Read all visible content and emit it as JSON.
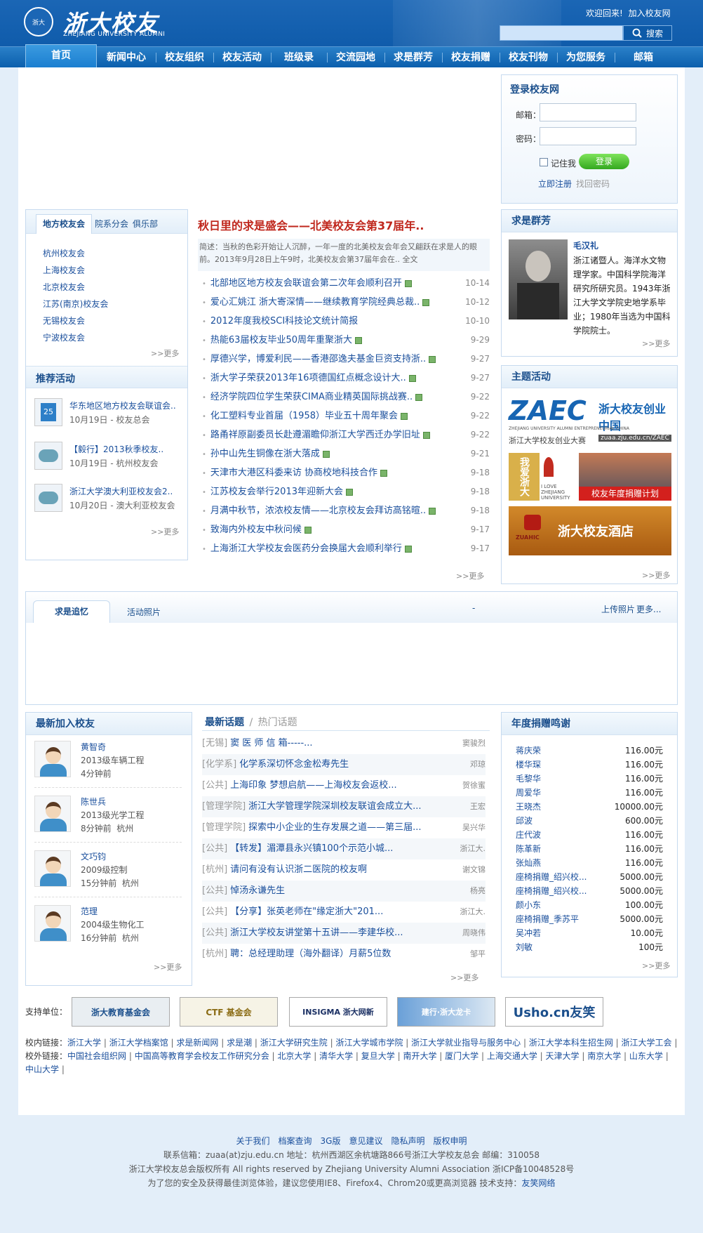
{
  "header": {
    "logo_seal": "浙大",
    "logo_text": "浙大校友",
    "logo_sub": "ZHEJIANG UNIVERSITY ALUMNI",
    "welcome": "欢迎回来!",
    "join": "加入校友网",
    "search_placeholder": "",
    "search_label": "搜索"
  },
  "nav": [
    "首页",
    "新闻中心",
    "校友组织",
    "校友活动",
    "班级录",
    "交流园地",
    "求是群芳",
    "校友捐赠",
    "校友刊物",
    "为您服务",
    "邮箱"
  ],
  "login": {
    "title": "登录校友网",
    "email_label": "邮箱：",
    "password_label": "密码：",
    "remember": "记住我",
    "submit": "登录",
    "register": "立即注册",
    "forgot": "找回密码"
  },
  "local": {
    "tabs": [
      "地方校友会",
      "院系分会",
      "俱乐部"
    ],
    "items": [
      "杭州校友会",
      "上海校友会",
      "北京校友会",
      "江苏(南京)校友会",
      "无锡校友会",
      "宁波校友会"
    ],
    "more": ">>更多"
  },
  "recommend": {
    "title": "推荐活动",
    "items": [
      {
        "title": "华东地区地方校友会联谊会..",
        "meta": "10月19日 - 校友总会",
        "badge": "25"
      },
      {
        "title": "【毅行】2013秋季校友..",
        "meta": "10月19日 - 杭州校友会",
        "badge": ""
      },
      {
        "title": "浙江大学澳大利亚校友会2..",
        "meta": "10月20日 - 澳大利亚校友会",
        "badge": ""
      }
    ],
    "more": ">>更多"
  },
  "headline": {
    "title": "秋日里的求是盛会——北美校友会第37届年..",
    "summary": "简述：当秋的色彩开始让人沉醉，一年一度的北美校友会年会又翩跃在求是人的眼前。2013年9月28日上午9时，北美校友会第37届年会在..  全文"
  },
  "news": [
    {
      "title": "北部地区地方校友会联谊会第二次年会顺利召开",
      "date": "10-14",
      "icon": true
    },
    {
      "title": "爱心汇姚江 浙大寄深情——继续教育学院经典总裁..",
      "date": "10-12",
      "icon": true
    },
    {
      "title": "2012年度我校SCI科技论文统计简报",
      "date": "10-10",
      "icon": false
    },
    {
      "title": "热能63届校友毕业50周年重聚浙大",
      "date": "9-29",
      "icon": true
    },
    {
      "title": "厚德兴学，博爱利民——香港邵逸夫基金巨资支持浙..",
      "date": "9-27",
      "icon": true
    },
    {
      "title": "浙大学子荣获2013年16项德国红点概念设计大..",
      "date": "9-27",
      "icon": true
    },
    {
      "title": "经济学院四位学生荣获CIMA商业精英国际挑战赛..",
      "date": "9-22",
      "icon": true
    },
    {
      "title": "化工塑料专业首届（1958）毕业五十周年聚会",
      "date": "9-22",
      "icon": true
    },
    {
      "title": "路甬祥原副委员长赴遵湄瞻仰浙江大学西迁办学旧址",
      "date": "9-22",
      "icon": true
    },
    {
      "title": "孙中山先生铜像在浙大落成",
      "date": "9-21",
      "icon": true
    },
    {
      "title": "天津市大港区科委来访 协商校地科技合作",
      "date": "9-18",
      "icon": true
    },
    {
      "title": "江苏校友会举行2013年迎新大会",
      "date": "9-18",
      "icon": true
    },
    {
      "title": "月满中秋节，浓浓校友情——北京校友会拜访高铭暄..",
      "date": "9-18",
      "icon": true
    },
    {
      "title": "致海内外校友中秋问候",
      "date": "9-17",
      "icon": true
    },
    {
      "title": "上海浙江大学校友会医药分会换届大会顺利举行",
      "date": "9-17",
      "icon": true
    }
  ],
  "news_more": ">>更多",
  "qiushi": {
    "title": "求是群芳",
    "name": "毛汉礼",
    "bio": "浙江诸暨人。海洋水文物理学家。中国科学院海洋研究所研究员。1943年浙江大学文学院史地学系毕业；1980年当选为中国科学院院士。",
    "more": ">>更多"
  },
  "theme": {
    "title": "主题活动",
    "zaec_logo": "ZAEC",
    "zaec_slogan": "浙大校友创业中国",
    "zaec_en": "ZHEJIANG UNIVERSITY ALUMNI ENTREPRENEURIAL CHINA",
    "zaec_cn": "浙江大学校友创业大赛",
    "zaec_url": "zuaa.zju.edu.cn/ZAEC",
    "donation_banner": "校友年度捐赠计划",
    "love_text": "我爱浙大",
    "love_en": "I LOVE ZHEJIANG UNIVERSITY",
    "hotel_logo": "ZUAHIC",
    "hotel_text": "浙大校友酒店",
    "more": ">>更多"
  },
  "memory": {
    "tabs": [
      "求是追忆",
      "活动照片"
    ],
    "dash": "-",
    "upload": "上传照片",
    "more": "更多..."
  },
  "new_members": {
    "title": "最新加入校友",
    "items": [
      {
        "name": "黄智奇",
        "line1": "2013级车辆工程",
        "line2": "4分钟前"
      },
      {
        "name": "陈世兵",
        "line1": "2013级光学工程",
        "line2": "8分钟前  杭州"
      },
      {
        "name": "文巧钧",
        "line1": "2009级控制",
        "line2": "15分钟前  杭州"
      },
      {
        "name": "范理",
        "line1": "2004级生物化工",
        "line2": "16分钟前  杭州"
      }
    ],
    "more": ">>更多"
  },
  "topics": {
    "tab_active": "最新话题",
    "sep": "/",
    "tab_other": "热门话题",
    "items": [
      {
        "cat": "[无锡]",
        "title": "窦 医 师 信 箱-----...",
        "author": "窦骏烈"
      },
      {
        "cat": "[化学系]",
        "title": "化学系深切怀念金松寿先生",
        "author": "邓琼"
      },
      {
        "cat": "[公共]",
        "title": "上海印象 梦想启航——上海校友会返校...",
        "author": "贺徐蜜"
      },
      {
        "cat": "[管理学院]",
        "title": "浙江大学管理学院深圳校友联谊会成立大...",
        "author": "王宏"
      },
      {
        "cat": "[管理学院]",
        "title": "探索中小企业的生存发展之道——第三届...",
        "author": "吴兴华"
      },
      {
        "cat": "[公共]",
        "title": "【转发】湄潭县永兴镇100个示范小城...",
        "author": "浙江大."
      },
      {
        "cat": "[杭州]",
        "title": "请问有没有认识浙二医院的校友啊",
        "author": "谢文锦"
      },
      {
        "cat": "[公共]",
        "title": "悼汤永谦先生",
        "author": "杨亮"
      },
      {
        "cat": "[公共]",
        "title": "【分享】张英老师在\"缘定浙大\"201...",
        "author": "浙江大."
      },
      {
        "cat": "[公共]",
        "title": "浙江大学校友讲堂第十五讲——李建华校...",
        "author": "周晓伟"
      },
      {
        "cat": "[杭州]",
        "title": "聘：总经理助理（海外翻译）月薪5位数",
        "author": "邹平"
      }
    ],
    "more": ">>更多"
  },
  "donations": {
    "title": "年度捐赠鸣谢",
    "items": [
      {
        "name": "蒋庆荣",
        "amount": "116.00元"
      },
      {
        "name": "楼华琛",
        "amount": "116.00元"
      },
      {
        "name": "毛黎华",
        "amount": "116.00元"
      },
      {
        "name": "周爱华",
        "amount": "116.00元"
      },
      {
        "name": "王晓杰",
        "amount": "10000.00元"
      },
      {
        "name": "邱波",
        "amount": "600.00元"
      },
      {
        "name": "庄代波",
        "amount": "116.00元"
      },
      {
        "name": "陈革新",
        "amount": "116.00元"
      },
      {
        "name": "张灿燕",
        "amount": "116.00元"
      },
      {
        "name": "座椅捐赠_绍兴校...",
        "amount": "5000.00元"
      },
      {
        "name": "座椅捐赠_绍兴校...",
        "amount": "5000.00元"
      },
      {
        "name": "颜小东",
        "amount": "100.00元"
      },
      {
        "name": "座椅捐赠_季苏平",
        "amount": "5000.00元"
      },
      {
        "name": "吴冲若",
        "amount": "10.00元"
      },
      {
        "name": "刘敏",
        "amount": "100元"
      }
    ],
    "more": ">>更多"
  },
  "sponsors": {
    "label": "支持单位：",
    "items": [
      "浙大教育基金会",
      "CTF 基金会",
      "INSIGMA 浙大网新",
      "建行·浙大龙卡",
      "Usho.cn友笑"
    ]
  },
  "links": {
    "inner_label": "校内链接：",
    "inner": [
      "浙江大学",
      "浙江大学档案馆",
      "求是新闻网",
      "求是潮",
      "浙江大学研究生院",
      "浙江大学城市学院",
      "浙江大学就业指导与服务中心",
      "浙江大学本科生招生网",
      "浙江大学工会"
    ],
    "outer_label": "校外链接：",
    "outer": [
      "中国社会组织网",
      "中国高等教育学会校友工作研究分会",
      "北京大学",
      "清华大学",
      "复旦大学",
      "南开大学",
      "厦门大学",
      "上海交通大学",
      "天津大学",
      "南京大学",
      "山东大学",
      "中山大学"
    ]
  },
  "footer": {
    "links": [
      "关于我们",
      "档案查询",
      "3G版",
      "意见建议",
      "隐私声明",
      "版权申明"
    ],
    "contact": "联系信箱：zuaa(at)zju.edu.cn  地址：杭州西湖区余杭塘路866号浙江大学校友总会  邮编：310058",
    "copyright": "浙江大学校友总会版权所有  All rights reserved by Zhejiang University Alumni Association  浙ICP备10048528号",
    "browser": "为了您的安全及获得最佳浏览体验，建议您使用IE8、Firefox4、Chrom20或更高浏览器  技术支持：",
    "tech": "友笑网络"
  },
  "colors": {
    "brand": "#0a57a6",
    "link": "#1a4f9c",
    "headline": "#c0281e",
    "login_btn": "#3fb02a"
  }
}
